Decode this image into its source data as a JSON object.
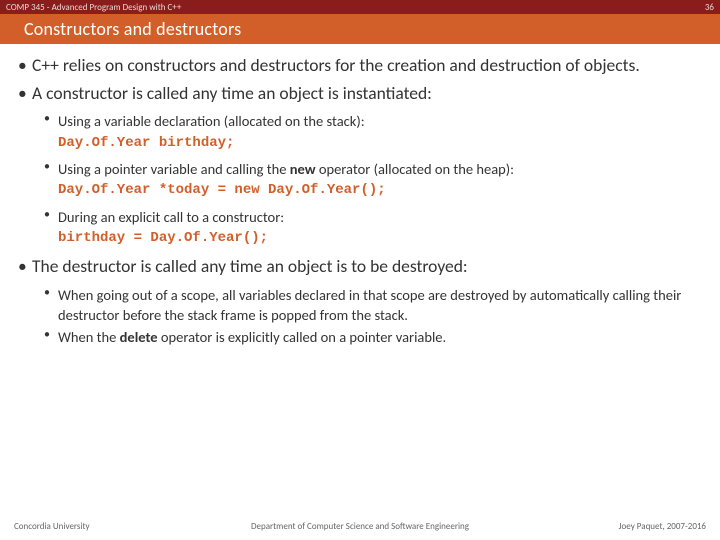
{
  "header": {
    "course": "COMP 345 - Advanced Program Design with C++",
    "slide_no": "36",
    "title": "Constructors and destructors"
  },
  "bullets": {
    "b1": "C++ relies on constructors and destructors for the creation and destruction of objects.",
    "b2": "A constructor is called any time an object is instantiated:",
    "b2_sub": {
      "s1": "Using a variable declaration (allocated on the stack):",
      "s1_code": "Day.Of.Year birthday;",
      "s2_pre": "Using a pointer variable and calling the ",
      "s2_bold": "new",
      "s2_post": " operator (allocated on the heap):",
      "s2_code": "Day.Of.Year *today = new Day.Of.Year();",
      "s3": "During an explicit call to a constructor:",
      "s3_code": "birthday = Day.Of.Year();"
    },
    "b3": "The destructor is called any time an object is to be destroyed:",
    "b3_sub": {
      "s1": "When going out of a scope, all variables declared in that scope are destroyed by automatically calling their destructor before the stack frame is popped from the stack.",
      "s2_pre": "When the ",
      "s2_bold": "delete",
      "s2_post": " operator is explicitly called on a pointer variable."
    }
  },
  "footer": {
    "left": "Concordia University",
    "center": "Department of Computer Science and Software Engineering",
    "right": "Joey Paquet, 2007-2016"
  }
}
